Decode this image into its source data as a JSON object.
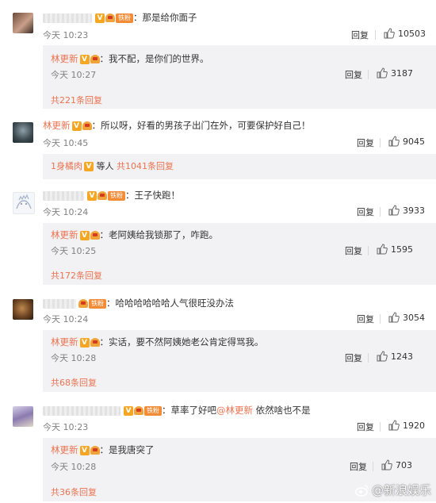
{
  "comments": [
    {
      "user_tag": "铁粉",
      "text": "那是给你面子",
      "time": "今天 10:23",
      "reply": "回复",
      "likes": "10503",
      "sub_reply": {
        "user": "林更新",
        "text": "我不配，是你们的世界。",
        "time": "今天 10:27",
        "reply": "回复",
        "likes": "3187",
        "more": "共221条回复"
      }
    },
    {
      "user": "林更新",
      "text": "所以呀，好看的男孩子出门在外，可要保护好自己！",
      "time": "今天 10:45",
      "reply": "回复",
      "likes": "9045",
      "footer": {
        "replier": "1身橘肉",
        "mid": "等人",
        "more": "共1041条回复"
      }
    },
    {
      "user_tag": "铁粉",
      "text": "王子快跑！",
      "time": "今天 10:24",
      "reply": "回复",
      "likes": "3933",
      "sub_reply": {
        "user": "林更新",
        "text": "老阿姨给我锁那了，咋跑。",
        "time": "今天 10:25",
        "reply": "回复",
        "likes": "1595",
        "more": "共172条回复"
      }
    },
    {
      "user_tag": "铁粉",
      "text": "哈哈哈哈哈哈人气很旺没办法",
      "time": "今天 10:24",
      "reply": "回复",
      "likes": "3054",
      "sub_reply": {
        "user": "林更新",
        "text": "实话，要不然阿姨她老公肯定得骂我。",
        "time": "今天 10:28",
        "reply": "回复",
        "likes": "1243",
        "more": "共68条回复"
      }
    },
    {
      "user_tag": "铁粉",
      "text_before": "草率了好吧",
      "mention": "@林更新",
      "text_after": " 依然啥也不是",
      "time": "今天 10:23",
      "reply": "回复",
      "likes": "1920",
      "sub_reply": {
        "user": "林更新",
        "text": "是我唐突了",
        "time": "今天 10:28",
        "reply": "回复",
        "likes": "703",
        "more": "共36条回复"
      }
    }
  ],
  "watermark": "@新浪娱乐",
  "colors": {
    "link": "#eb7350",
    "subbox_bg": "#f2f2f5",
    "badge": "#f5a623"
  }
}
